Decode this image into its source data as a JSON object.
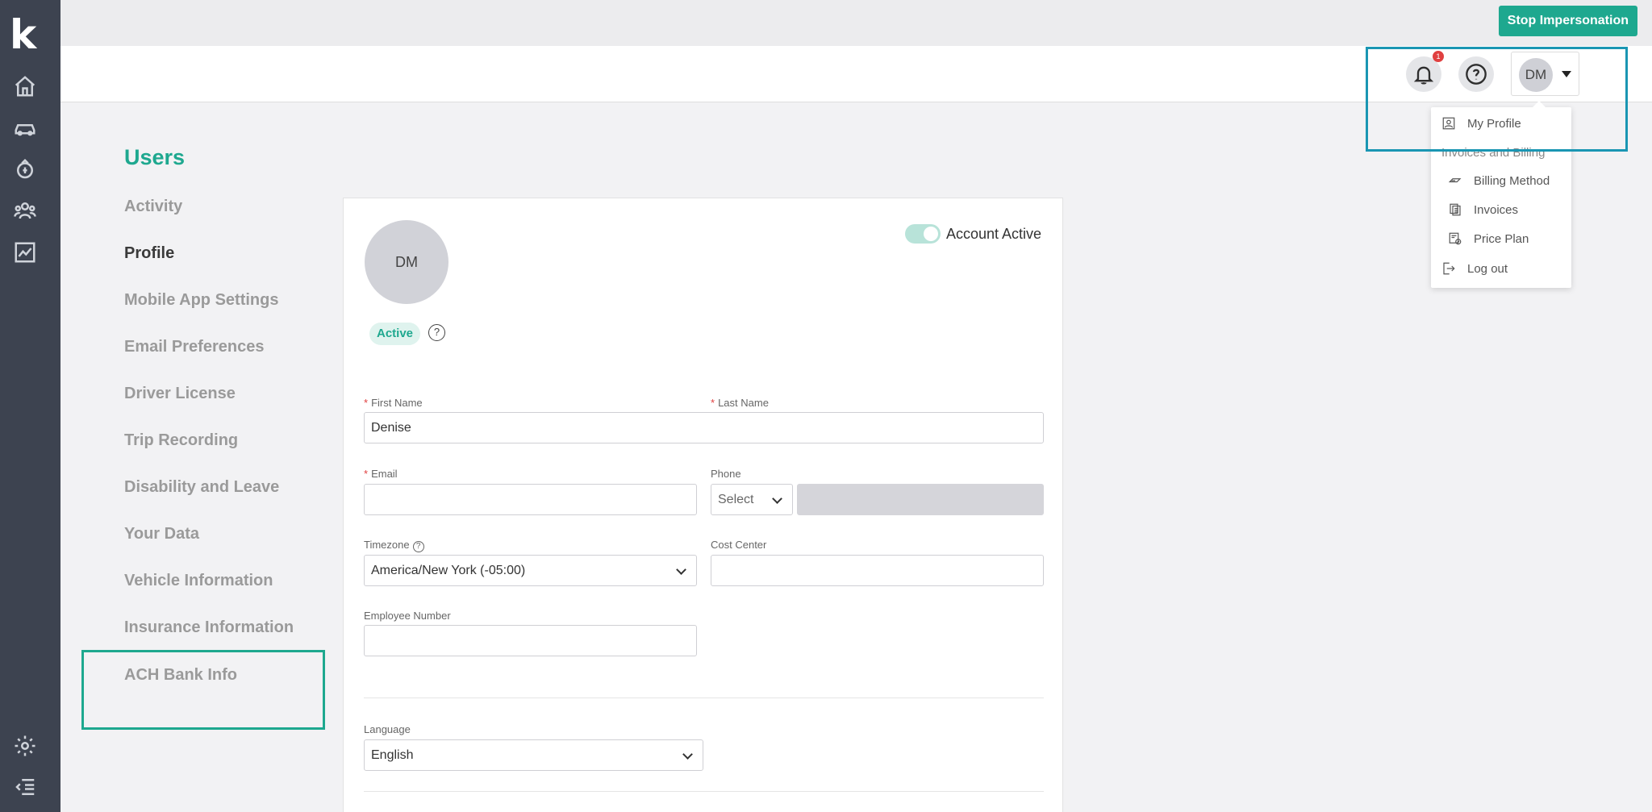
{
  "app": {
    "logo_letter": "k"
  },
  "topbar": {
    "stop_impersonation": "Stop Impersonation"
  },
  "header": {
    "notification_count": "1",
    "user_initials": "DM"
  },
  "user_menu": {
    "my_profile": "My Profile",
    "section_label": "Invoices and Billing",
    "billing_method": "Billing Method",
    "invoices": "Invoices",
    "price_plan": "Price Plan",
    "log_out": "Log out"
  },
  "nav": {
    "title": "Users",
    "items": [
      "Activity",
      "Profile",
      "Mobile App Settings",
      "Email Preferences",
      "Driver License",
      "Trip Recording",
      "Disability and Leave",
      "Your Data",
      "Vehicle Information",
      "Insurance Information",
      "ACH Bank Info"
    ],
    "active_item": "Profile"
  },
  "profile": {
    "initials": "DM",
    "account_active_label": "Account Active",
    "status": "Active",
    "help_glyph": "?",
    "first_name_label": "First Name",
    "first_name": "Denise",
    "last_name_label": "Last Name",
    "email_label": "Email",
    "phone_label": "Phone",
    "phone_select": "Select",
    "timezone_label": "Timezone",
    "timezone": "America/New York (-05:00)",
    "cost_center_label": "Cost Center",
    "employee_number_label": "Employee Number",
    "language_label": "Language",
    "language": "English",
    "required_mark": "*"
  },
  "colors": {
    "accent": "#1ea88f",
    "rail": "#3d4350",
    "highlight_blue": "#1a96b3"
  }
}
